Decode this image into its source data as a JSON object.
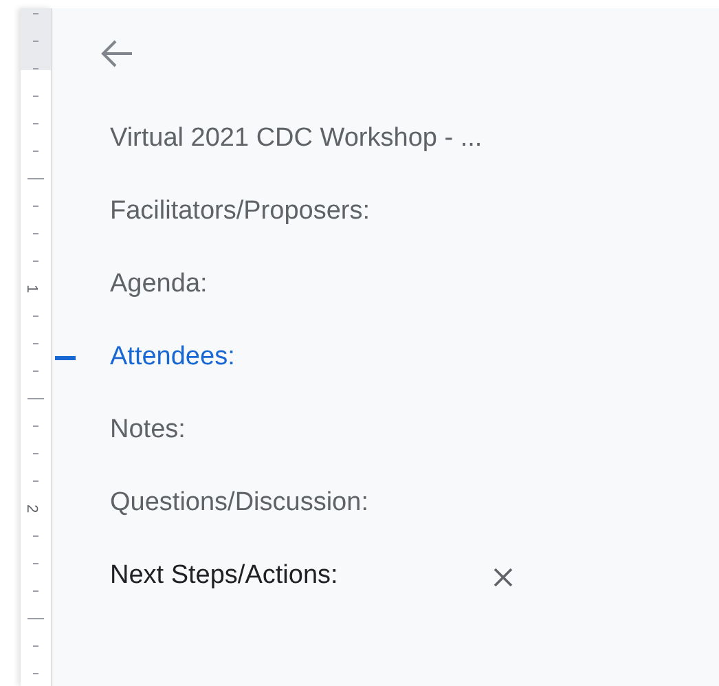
{
  "ruler": {
    "labels": [
      "1",
      "2"
    ]
  },
  "outline": {
    "items": [
      {
        "text": "Virtual 2021 CDC Workshop - ...",
        "selected": false,
        "hovered": false
      },
      {
        "text": "Facilitators/Proposers:",
        "selected": false,
        "hovered": false
      },
      {
        "text": "Agenda:",
        "selected": false,
        "hovered": false
      },
      {
        "text": "Attendees:",
        "selected": true,
        "hovered": false
      },
      {
        "text": "Notes:",
        "selected": false,
        "hovered": false
      },
      {
        "text": "Questions/Discussion:",
        "selected": false,
        "hovered": false
      },
      {
        "text": "Next Steps/Actions:",
        "selected": false,
        "hovered": true
      }
    ]
  }
}
